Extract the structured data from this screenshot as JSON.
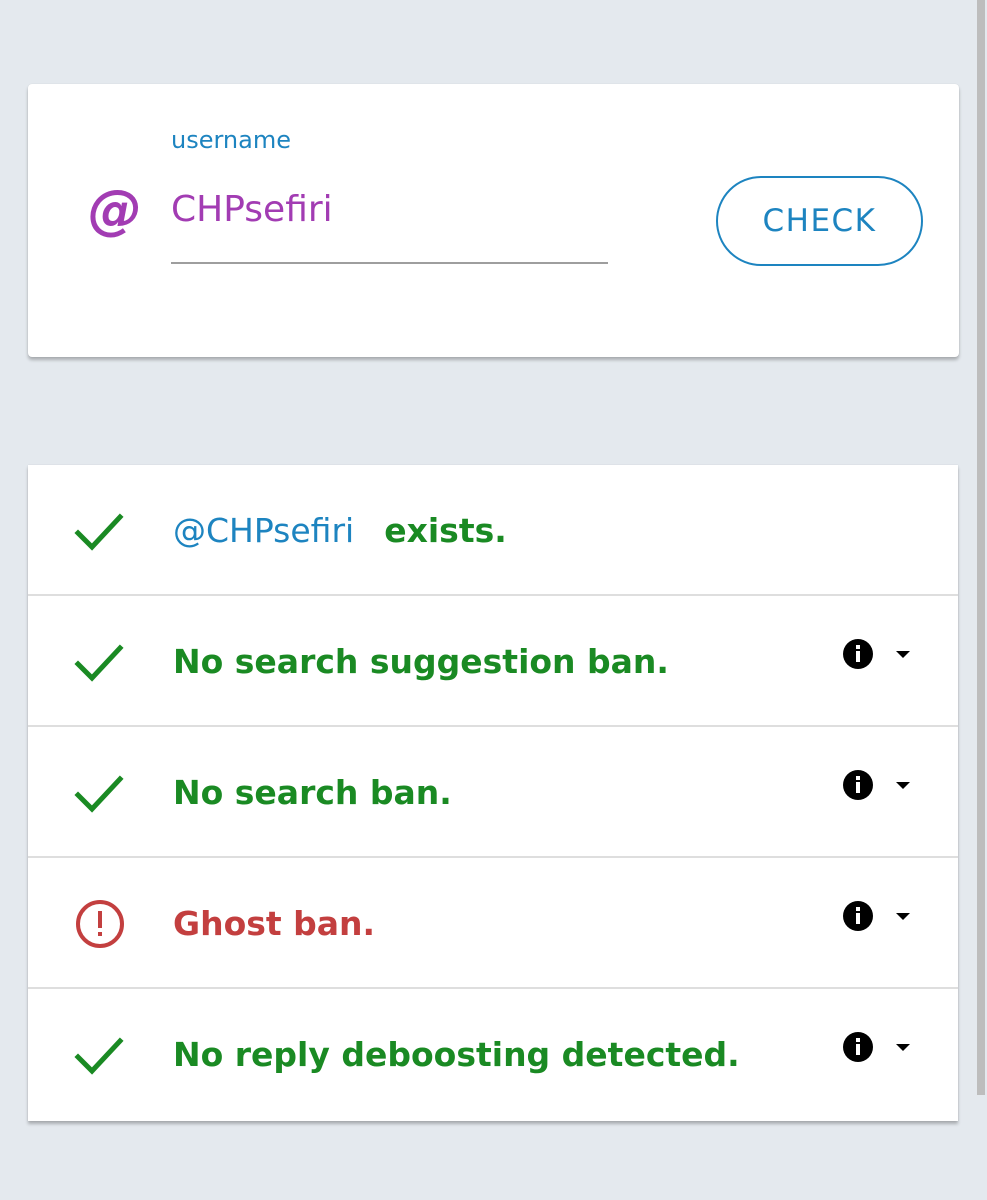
{
  "search": {
    "label": "username",
    "value": "CHPsefiri",
    "prefix_icon": "at-sign-icon",
    "button_label": "CHECK"
  },
  "results": [
    {
      "status": "ok",
      "icon": "check-icon",
      "handle": "@CHPsefiri",
      "text": "exists.",
      "has_details": false
    },
    {
      "status": "ok",
      "icon": "check-icon",
      "text": "No search suggestion ban.",
      "has_details": true
    },
    {
      "status": "ok",
      "icon": "check-icon",
      "text": "No search ban.",
      "has_details": true
    },
    {
      "status": "error",
      "icon": "exclamation-circle-icon",
      "text": "Ghost ban.",
      "has_details": true
    },
    {
      "status": "ok",
      "icon": "check-icon",
      "text": "No reply deboosting detected.",
      "has_details": true
    }
  ],
  "colors": {
    "accent_blue": "#1d84c0",
    "handle_purple": "#a23cb3",
    "success_green": "#1a8a23",
    "error_red": "#c33f3f",
    "background": "#e4e9ee"
  }
}
